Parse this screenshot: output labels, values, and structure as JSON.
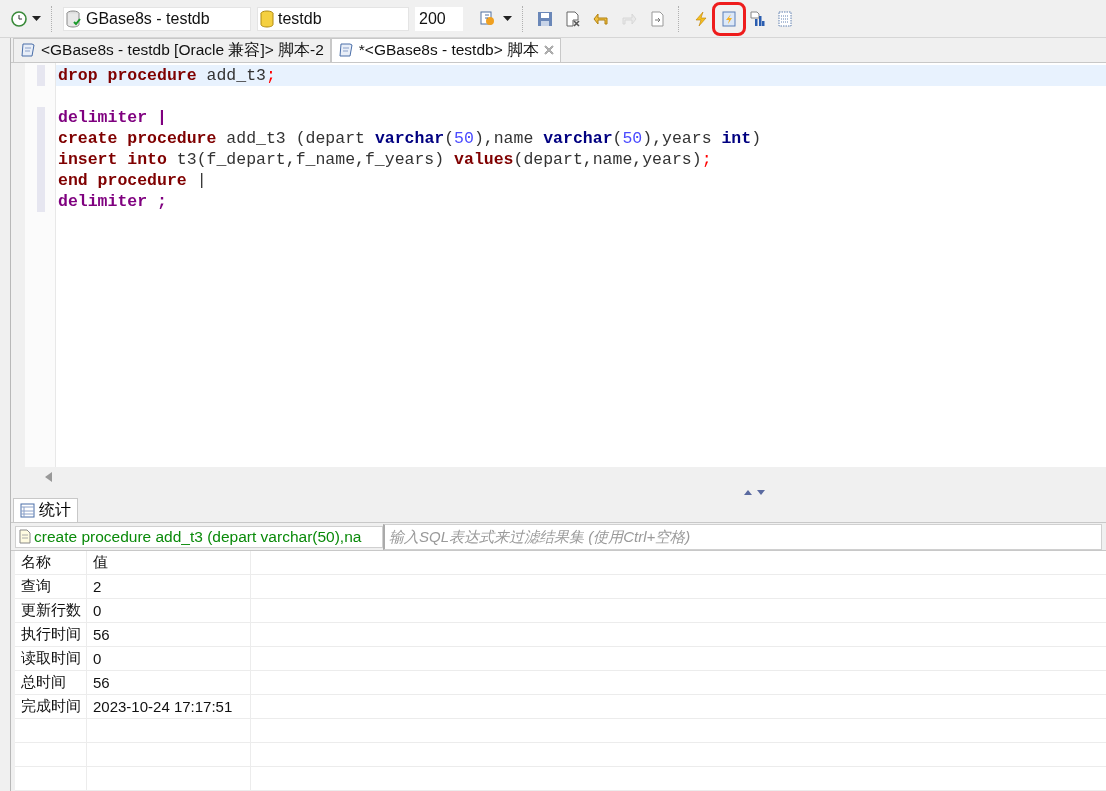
{
  "toolbar": {
    "connection": "GBase8s - testdb",
    "database": "testdb",
    "row_limit": "200",
    "buttons": [
      {
        "kind": "save",
        "disabled": false,
        "highlighted": false
      },
      {
        "kind": "clear",
        "disabled": false,
        "highlighted": false
      },
      {
        "kind": "undo",
        "disabled": false,
        "highlighted": false
      },
      {
        "kind": "redo",
        "disabled": true,
        "highlighted": false
      },
      {
        "kind": "format",
        "disabled": false,
        "highlighted": false
      },
      {
        "kind": "execute",
        "disabled": false,
        "highlighted": false
      },
      {
        "kind": "script",
        "disabled": false,
        "highlighted": true
      },
      {
        "kind": "plan",
        "disabled": false,
        "highlighted": false
      },
      {
        "kind": "grid",
        "disabled": false,
        "highlighted": false
      }
    ]
  },
  "editor_tabs": [
    {
      "label": "<GBase8s - testdb [Oracle 兼容]> 脚本-2",
      "selected": false
    },
    {
      "label": "*<GBase8s - testdb> 脚本",
      "selected": true
    }
  ],
  "editor": {
    "lines": [
      {
        "current": true,
        "tokens": [
          {
            "text": "drop procedure",
            "kind": "keyword"
          },
          {
            "text": " add_t3",
            "kind": "plain"
          },
          {
            "text": ";",
            "kind": "punct"
          }
        ]
      },
      {
        "current": false
      },
      {
        "current": false,
        "tokens": [
          {
            "text": "delimiter |",
            "kind": "directive"
          }
        ]
      },
      {
        "current": false,
        "tokens": [
          {
            "text": "create procedure",
            "kind": "keyword"
          },
          {
            "text": " add_t3 (depart ",
            "kind": "plain"
          },
          {
            "text": "varchar",
            "kind": "type"
          },
          {
            "text": "(",
            "kind": "plain"
          },
          {
            "text": "50",
            "kind": "number"
          },
          {
            "text": "),name ",
            "kind": "plain"
          },
          {
            "text": "varchar",
            "kind": "type"
          },
          {
            "text": "(",
            "kind": "plain"
          },
          {
            "text": "50",
            "kind": "number"
          },
          {
            "text": "),years ",
            "kind": "plain"
          },
          {
            "text": "int",
            "kind": "type"
          },
          {
            "text": ")",
            "kind": "plain"
          }
        ]
      },
      {
        "current": false,
        "tokens": [
          {
            "text": "insert into",
            "kind": "keyword"
          },
          {
            "text": " t3(f_depart,f_name,f_years) ",
            "kind": "plain"
          },
          {
            "text": "values",
            "kind": "keyword"
          },
          {
            "text": "(depart,name,years)",
            "kind": "plain"
          },
          {
            "text": ";",
            "kind": "punct"
          }
        ]
      },
      {
        "current": false,
        "tokens": [
          {
            "text": "end procedure",
            "kind": "keyword"
          },
          {
            "text": " |",
            "kind": "plain"
          }
        ]
      },
      {
        "current": false,
        "tokens": [
          {
            "text": "delimiter ;",
            "kind": "directive"
          }
        ]
      }
    ]
  },
  "results": {
    "tab": "统计",
    "query": "create procedure add_t3 (depart varchar(50),na",
    "filter_placeholder": "输入SQL表达式来过滤结果集 (使用Ctrl+空格)",
    "columns": [
      "名称",
      "值"
    ],
    "rows": [
      [
        "查询",
        "2"
      ],
      [
        "更新行数",
        "0"
      ],
      [
        "执行时间",
        "56"
      ],
      [
        "读取时间",
        "0"
      ],
      [
        "总时间",
        "56"
      ],
      [
        "完成时间",
        "2023-10-24 17:17:51"
      ]
    ]
  }
}
